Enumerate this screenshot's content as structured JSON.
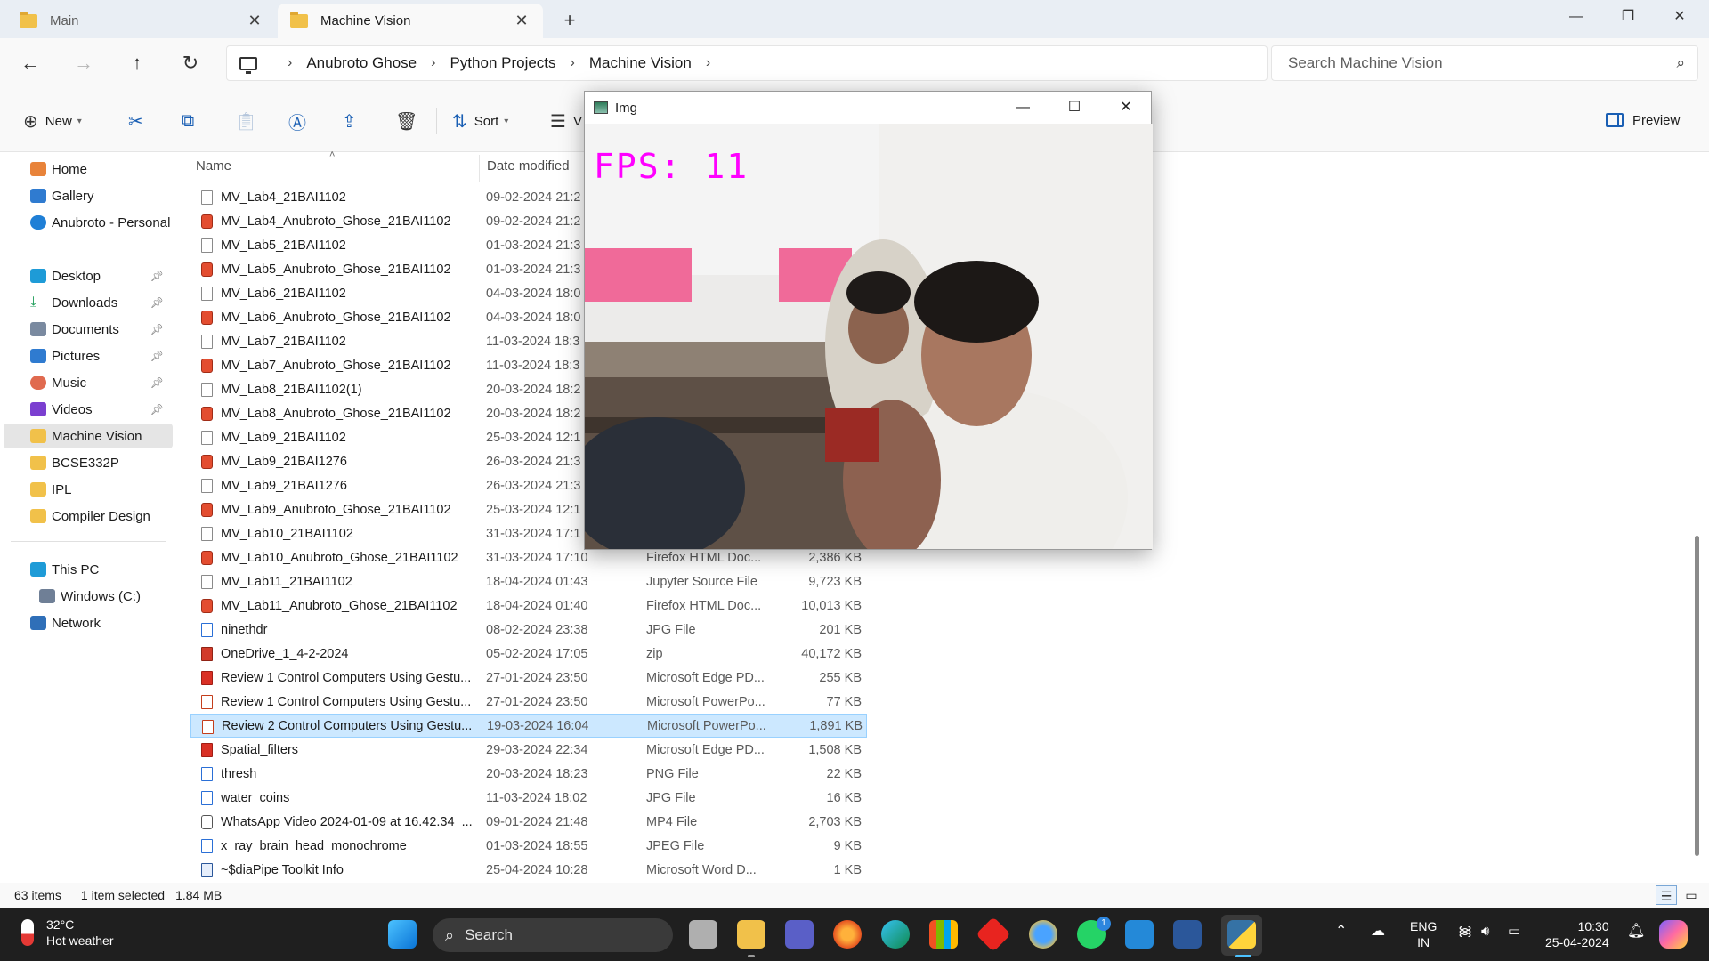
{
  "tabs": [
    {
      "label": "Main"
    },
    {
      "label": "Machine Vision"
    }
  ],
  "address": {
    "crumbs": [
      "Anubroto Ghose",
      "Python Projects",
      "Machine Vision"
    ],
    "search_placeholder": "Search Machine Vision"
  },
  "commandbar": {
    "new_label": "New",
    "sort_label": "Sort",
    "view_label": "V",
    "preview_label": "Preview"
  },
  "nav": {
    "quick": [
      "Home",
      "Gallery",
      "Anubroto - Personal"
    ],
    "pinned": [
      "Desktop",
      "Downloads",
      "Documents",
      "Pictures",
      "Music",
      "Videos"
    ],
    "folders": [
      "Machine Vision",
      "BCSE332P",
      "IPL",
      "Compiler Design"
    ],
    "devices": [
      "This PC",
      "Windows (C:)",
      "Network"
    ]
  },
  "columns": {
    "name": "Name",
    "date": "Date modified"
  },
  "files": [
    {
      "name": "MV_Lab4_21BAI1102",
      "date": "09-02-2024 21:2",
      "type": "",
      "size": "",
      "kind": "doc"
    },
    {
      "name": "MV_Lab4_Anubroto_Ghose_21BAI1102",
      "date": "09-02-2024 21:2",
      "type": "",
      "size": "",
      "kind": "html"
    },
    {
      "name": "MV_Lab5_21BAI1102",
      "date": "01-03-2024 21:3",
      "type": "",
      "size": "",
      "kind": "doc"
    },
    {
      "name": "MV_Lab5_Anubroto_Ghose_21BAI1102",
      "date": "01-03-2024 21:3",
      "type": "",
      "size": "",
      "kind": "html"
    },
    {
      "name": "MV_Lab6_21BAI1102",
      "date": "04-03-2024 18:0",
      "type": "",
      "size": "",
      "kind": "doc"
    },
    {
      "name": "MV_Lab6_Anubroto_Ghose_21BAI1102",
      "date": "04-03-2024 18:0",
      "type": "",
      "size": "",
      "kind": "html"
    },
    {
      "name": "MV_Lab7_21BAI1102",
      "date": "11-03-2024 18:3",
      "type": "",
      "size": "",
      "kind": "doc"
    },
    {
      "name": "MV_Lab7_Anubroto_Ghose_21BAI1102",
      "date": "11-03-2024 18:3",
      "type": "",
      "size": "",
      "kind": "html"
    },
    {
      "name": "MV_Lab8_21BAI1102(1)",
      "date": "20-03-2024 18:2",
      "type": "",
      "size": "",
      "kind": "doc"
    },
    {
      "name": "MV_Lab8_Anubroto_Ghose_21BAI1102",
      "date": "20-03-2024 18:2",
      "type": "",
      "size": "",
      "kind": "html"
    },
    {
      "name": "MV_Lab9_21BAI1102",
      "date": "25-03-2024 12:1",
      "type": "",
      "size": "",
      "kind": "doc"
    },
    {
      "name": "MV_Lab9_21BAI1276",
      "date": "26-03-2024 21:3",
      "type": "",
      "size": "",
      "kind": "html"
    },
    {
      "name": "MV_Lab9_21BAI1276",
      "date": "26-03-2024 21:3",
      "type": "",
      "size": "",
      "kind": "doc"
    },
    {
      "name": "MV_Lab9_Anubroto_Ghose_21BAI1102",
      "date": "25-03-2024 12:1",
      "type": "",
      "size": "",
      "kind": "html"
    },
    {
      "name": "MV_Lab10_21BAI1102",
      "date": "31-03-2024 17:1",
      "type": "",
      "size": "",
      "kind": "doc"
    },
    {
      "name": "MV_Lab10_Anubroto_Ghose_21BAI1102",
      "date": "31-03-2024 17:10",
      "type": "Firefox HTML Doc...",
      "size": "2,386 KB",
      "kind": "html"
    },
    {
      "name": "MV_Lab11_21BAI1102",
      "date": "18-04-2024 01:43",
      "type": "Jupyter Source File",
      "size": "9,723 KB",
      "kind": "doc"
    },
    {
      "name": "MV_Lab11_Anubroto_Ghose_21BAI1102",
      "date": "18-04-2024 01:40",
      "type": "Firefox HTML Doc...",
      "size": "10,013 KB",
      "kind": "html"
    },
    {
      "name": "ninethdr",
      "date": "08-02-2024 23:38",
      "type": "JPG File",
      "size": "201 KB",
      "kind": "img"
    },
    {
      "name": "OneDrive_1_4-2-2024",
      "date": "05-02-2024 17:05",
      "type": "zip",
      "size": "40,172 KB",
      "kind": "zip"
    },
    {
      "name": "Review 1 Control Computers Using Gestu...",
      "date": "27-01-2024 23:50",
      "type": "Microsoft Edge PD...",
      "size": "255 KB",
      "kind": "pdf"
    },
    {
      "name": "Review 1 Control Computers Using Gestu...",
      "date": "27-01-2024 23:50",
      "type": "Microsoft PowerPo...",
      "size": "77 KB",
      "kind": "ppt"
    },
    {
      "name": "Review 2 Control Computers Using Gestu...",
      "date": "19-03-2024 16:04",
      "type": "Microsoft PowerPo...",
      "size": "1,891 KB",
      "kind": "ppt",
      "selected": true
    },
    {
      "name": "Spatial_filters",
      "date": "29-03-2024 22:34",
      "type": "Microsoft Edge PD...",
      "size": "1,508 KB",
      "kind": "pdf"
    },
    {
      "name": "thresh",
      "date": "20-03-2024 18:23",
      "type": "PNG File",
      "size": "22 KB",
      "kind": "img"
    },
    {
      "name": "water_coins",
      "date": "11-03-2024 18:02",
      "type": "JPG File",
      "size": "16 KB",
      "kind": "img"
    },
    {
      "name": "WhatsApp Video 2024-01-09 at 16.42.34_...",
      "date": "09-01-2024 21:48",
      "type": "MP4 File",
      "size": "2,703 KB",
      "kind": "mp4"
    },
    {
      "name": "x_ray_brain_head_monochrome",
      "date": "01-03-2024 18:55",
      "type": "JPEG File",
      "size": "9 KB",
      "kind": "img"
    },
    {
      "name": "~$diaPipe Toolkit Info",
      "date": "25-04-2024 10:28",
      "type": "Microsoft Word D...",
      "size": "1 KB",
      "kind": "word"
    }
  ],
  "status": {
    "count": "63 items",
    "selection": "1 item selected",
    "size": "1.84 MB"
  },
  "cvwindow": {
    "title": "Img",
    "fps_text": "FPS: 11"
  },
  "taskbar": {
    "temperature": "32°C",
    "weather": "Hot weather",
    "search_label": "Search",
    "lang_top": "ENG",
    "lang_bottom": "IN",
    "time": "10:30",
    "date": "25-04-2024",
    "whatsapp_badge": "1"
  },
  "colors": {
    "accent": "#1a5fb4",
    "selection": "#cce8ff",
    "fps_overlay": "#ff00ff",
    "taskbar": "#1f1f1f",
    "folder": "#f1c14a"
  }
}
